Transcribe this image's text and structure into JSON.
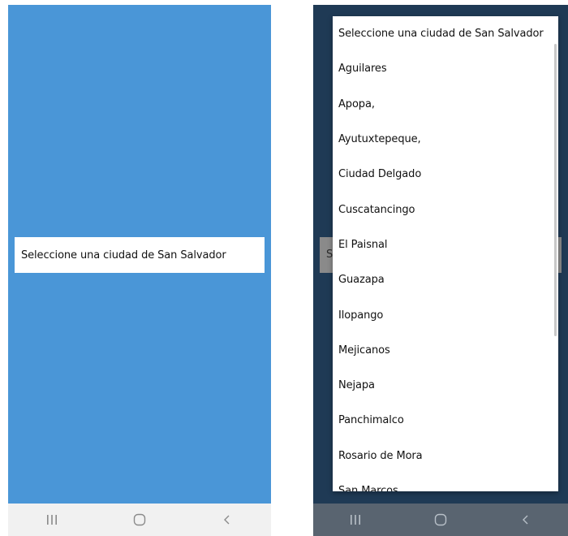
{
  "left_screen": {
    "spinner_label": "Seleccione una ciudad de San Salvador"
  },
  "right_screen": {
    "behind_spinner_letter": "S",
    "dropdown": {
      "items": [
        "Seleccione una ciudad de San Salvador",
        "Aguilares",
        "Apopa,",
        "Ayutuxtepeque,",
        "Ciudad Delgado",
        "Cuscatancingo",
        "El Paisnal",
        "Guazapa",
        "Ilopango",
        "Mejicanos",
        "Nejapa",
        "Panchimalco",
        "Rosario de Mora",
        "San Marcos"
      ]
    }
  },
  "navbar": {
    "icons": [
      "recent-apps-icon",
      "home-icon",
      "back-icon"
    ]
  },
  "colors": {
    "left_background": "#4a96d7",
    "right_background": "#1f3a55",
    "left_navbar": "#f1f1f1",
    "right_navbar": "#596470"
  }
}
